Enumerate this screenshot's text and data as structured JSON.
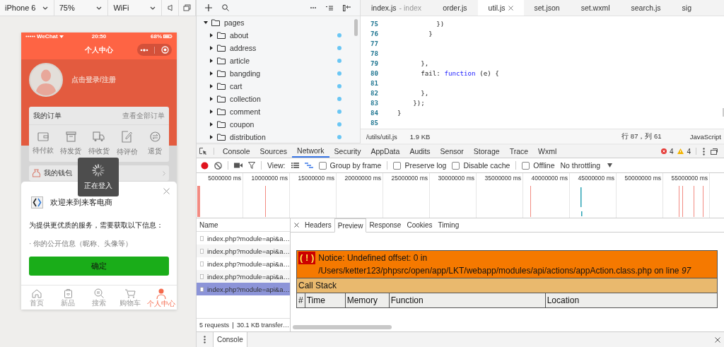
{
  "simulator": {
    "device": "iPhone 6",
    "zoom": "75%",
    "network": "WiFi"
  },
  "phone": {
    "status": {
      "carrier": "WeChat",
      "time": "20:50",
      "battery": "68%"
    },
    "title": "个人中心",
    "login": "点击登录/注册",
    "orders": {
      "title": "我的订单",
      "link": "查看全部订单",
      "items": [
        {
          "label": "待付款",
          "kind": "wallet"
        },
        {
          "label": "待发货",
          "kind": "box"
        },
        {
          "label": "待收货",
          "kind": "truck"
        },
        {
          "label": "待评价",
          "kind": "edit"
        },
        {
          "label": "退货",
          "kind": "refund"
        }
      ]
    },
    "wallet": "我的钱包",
    "toast": "正在登入",
    "dialog": {
      "title": "欢迎来到来客电商",
      "description": "为提供更优质的服务，需要获取以下信息：",
      "items": [
        "· 你的公开信息（昵称、头像等）"
      ],
      "button": "确定"
    },
    "tabbar": [
      {
        "label": "首页",
        "kind": "home",
        "selected": false
      },
      {
        "label": "新品",
        "kind": "bag",
        "selected": false
      },
      {
        "label": "搜索",
        "kind": "search",
        "selected": false
      },
      {
        "label": "购物车",
        "kind": "cart",
        "selected": false
      },
      {
        "label": "个人中心",
        "kind": "person",
        "selected": true
      }
    ]
  },
  "file_tree": {
    "name": "pages",
    "expanded": true,
    "children": [
      {
        "name": "about",
        "expanded": false,
        "modified": true
      },
      {
        "name": "address",
        "expanded": false,
        "modified": true
      },
      {
        "name": "article",
        "expanded": false,
        "modified": true
      },
      {
        "name": "bangding",
        "expanded": false,
        "modified": true
      },
      {
        "name": "cart",
        "expanded": false,
        "modified": true
      },
      {
        "name": "collection",
        "expanded": false,
        "modified": true
      },
      {
        "name": "comment",
        "expanded": false,
        "modified": true
      },
      {
        "name": "coupon",
        "expanded": false,
        "modified": true
      },
      {
        "name": "distribution",
        "expanded": false,
        "modified": true
      }
    ]
  },
  "editor": {
    "tabs": [
      {
        "label": "index.js",
        "hint": "- index",
        "selected": false
      },
      {
        "label": "order.js",
        "selected": false
      },
      {
        "label": "util.js",
        "selected": true
      },
      {
        "label": "set.json",
        "selected": false
      },
      {
        "label": "set.wxml",
        "selected": false
      },
      {
        "label": "search.js",
        "selected": false
      },
      {
        "label": "sig",
        "selected": false
      }
    ],
    "lines": [
      {
        "number": "75",
        "code": [
          {
            "text": "          })"
          }
        ]
      },
      {
        "number": "76",
        "code": [
          {
            "text": "        }"
          }
        ]
      },
      {
        "number": "77"
      },
      {
        "number": "78"
      },
      {
        "number": "79",
        "code": [
          {
            "text": "      },"
          }
        ]
      },
      {
        "number": "80",
        "code": [
          {
            "text": "      fail: "
          },
          {
            "text": "function",
            "kind": "keyword"
          },
          {
            "text": " (e) {"
          }
        ]
      },
      {
        "number": "81"
      },
      {
        "number": "82",
        "code": [
          {
            "text": "      },"
          }
        ]
      },
      {
        "number": "83",
        "code": [
          {
            "text": "    });"
          }
        ]
      },
      {
        "number": "84",
        "code": [
          {
            "text": "}"
          }
        ]
      },
      {
        "number": "85"
      }
    ],
    "status_bar": {
      "path": "/utils/util.js",
      "size": "1.9 KB",
      "position": "行 87，列 61",
      "language": "JavaScript"
    }
  },
  "devtools": {
    "tabs": [
      {
        "label": "Console",
        "selected": false
      },
      {
        "label": "Sources",
        "selected": false
      },
      {
        "label": "Network",
        "selected": true
      },
      {
        "label": "Security",
        "selected": false
      },
      {
        "label": "AppData",
        "selected": false
      },
      {
        "label": "Audits",
        "selected": false
      },
      {
        "label": "Sensor",
        "selected": false
      },
      {
        "label": "Storage",
        "selected": false
      },
      {
        "label": "Trace",
        "selected": false
      },
      {
        "label": "Wxml",
        "selected": false
      }
    ],
    "errors": "4",
    "warnings": "4",
    "network": {
      "view_label": "View:",
      "options": [
        {
          "label": "Group by frame",
          "checked": false
        },
        {
          "label": "Preserve log",
          "checked": false
        },
        {
          "label": "Disable cache",
          "checked": false
        },
        {
          "label": "Offline",
          "checked": false
        }
      ],
      "throttling": "No throttling",
      "ticks": [
        "5000000 ms",
        "10000000 ms",
        "15000000 ms",
        "20000000 ms",
        "25000000 ms",
        "30000000 ms",
        "35000000 ms",
        "40000000 ms",
        "45000000 ms",
        "50000000 ms",
        "55000000 ms"
      ],
      "name_header": "Name",
      "requests": [
        {
          "name": "index.php?module=api&a…",
          "selected": false
        },
        {
          "name": "index.php?module=api&a…",
          "selected": false
        },
        {
          "name": "index.php?module=api&a…",
          "selected": false
        },
        {
          "name": "index.php?module=api&a…",
          "selected": false
        },
        {
          "name": "index.php?module=api&a…",
          "selected": true
        }
      ],
      "summary": [
        "5 requests",
        "30.1 KB transfer…"
      ],
      "detail_tabs": [
        {
          "label": "Headers",
          "selected": false
        },
        {
          "label": "Preview",
          "selected": true
        },
        {
          "label": "Response",
          "selected": false
        },
        {
          "label": "Cookies",
          "selected": false
        },
        {
          "label": "Timing",
          "selected": false
        }
      ],
      "preview": {
        "badge": "( ! )",
        "notice": "Notice: Undefined offset: 0 in /Users/ketter123/phpsrc/open/app/LKT/webapp/modules/api/actions/appAction.class.php on line *97*",
        "section": "Call Stack",
        "columns": [
          "#",
          "Time",
          "Memory",
          "Function",
          "Location"
        ]
      }
    },
    "drawer": {
      "tabs": [
        {
          "label": "Console",
          "selected": true
        }
      ]
    }
  }
}
